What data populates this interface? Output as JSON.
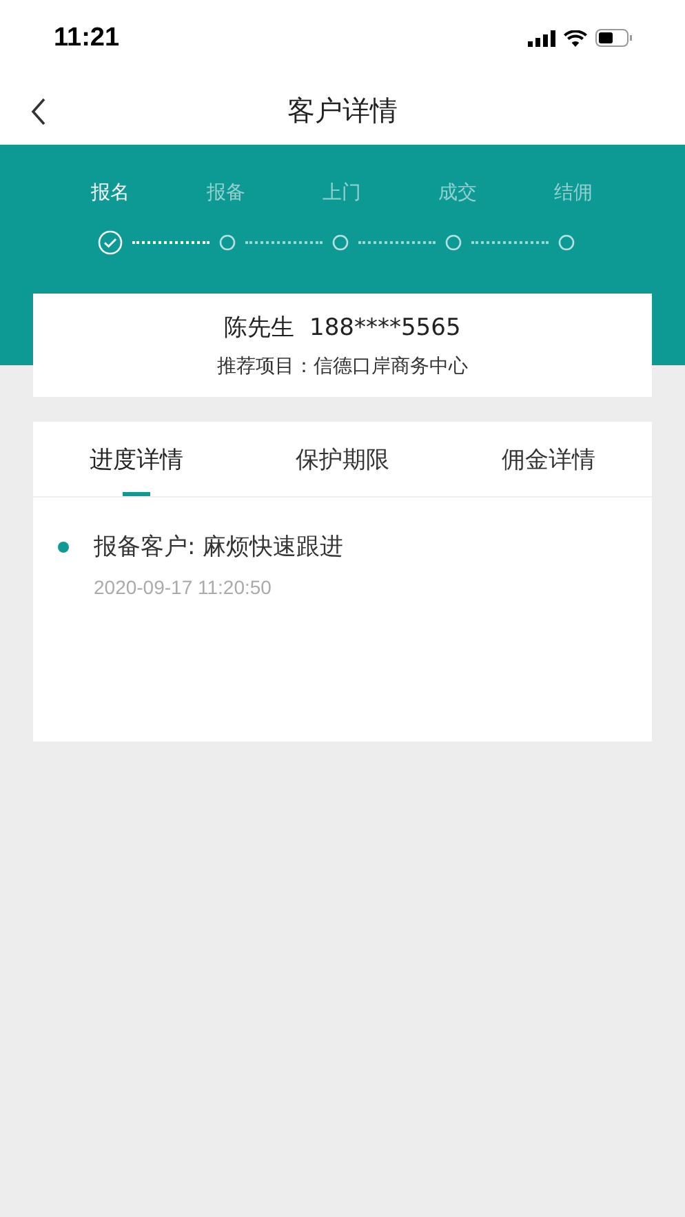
{
  "status_bar": {
    "time": "11:21"
  },
  "nav": {
    "title": "客户详情"
  },
  "steps": [
    {
      "label": "报名",
      "done": true
    },
    {
      "label": "报备",
      "done": false
    },
    {
      "label": "上门",
      "done": false
    },
    {
      "label": "成交",
      "done": false
    },
    {
      "label": "结佣",
      "done": false
    }
  ],
  "customer": {
    "name": "陈先生",
    "phone": "188****5565",
    "project": "推荐项目：信德口岸商务中心"
  },
  "tabs": [
    {
      "label": "进度详情",
      "selected": true
    },
    {
      "label": "保护期限",
      "selected": false
    },
    {
      "label": "佣金详情",
      "selected": false
    }
  ],
  "records": [
    {
      "title": "报备客户: 麻烦快速跟进",
      "time": "2020-09-17 11:20:50"
    }
  ]
}
